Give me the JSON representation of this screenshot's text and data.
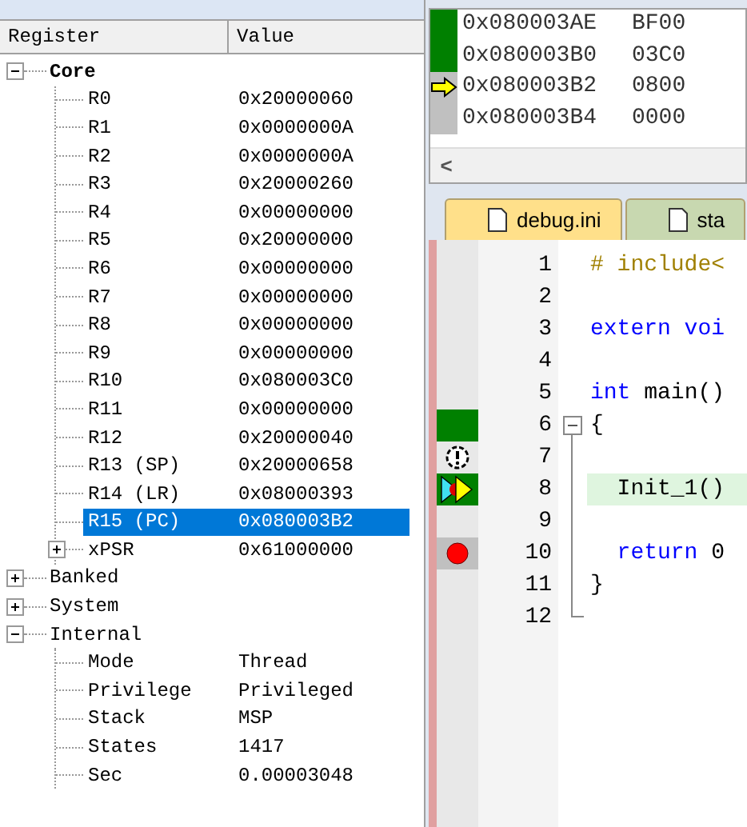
{
  "registers": {
    "columns": [
      "Register",
      "Value"
    ],
    "groups": [
      {
        "label": "Core",
        "bold": true,
        "expanded": true,
        "children": [
          {
            "name": "R0",
            "value": "0x20000060",
            "kind": "leaf",
            "selected": false
          },
          {
            "name": "R1",
            "value": "0x0000000A",
            "kind": "leaf",
            "selected": false
          },
          {
            "name": "R2",
            "value": "0x0000000A",
            "kind": "leaf",
            "selected": false
          },
          {
            "name": "R3",
            "value": "0x20000260",
            "kind": "leaf",
            "selected": false
          },
          {
            "name": "R4",
            "value": "0x00000000",
            "kind": "leaf",
            "selected": false
          },
          {
            "name": "R5",
            "value": "0x20000000",
            "kind": "leaf",
            "selected": false
          },
          {
            "name": "R6",
            "value": "0x00000000",
            "kind": "leaf",
            "selected": false
          },
          {
            "name": "R7",
            "value": "0x00000000",
            "kind": "leaf",
            "selected": false
          },
          {
            "name": "R8",
            "value": "0x00000000",
            "kind": "leaf",
            "selected": false
          },
          {
            "name": "R9",
            "value": "0x00000000",
            "kind": "leaf",
            "selected": false
          },
          {
            "name": "R10",
            "value": "0x080003C0",
            "kind": "leaf",
            "selected": false
          },
          {
            "name": "R11",
            "value": "0x00000000",
            "kind": "leaf",
            "selected": false
          },
          {
            "name": "R12",
            "value": "0x20000040",
            "kind": "leaf",
            "selected": false
          },
          {
            "name": "R13 (SP)",
            "value": "0x20000658",
            "kind": "leaf",
            "selected": false
          },
          {
            "name": "R14 (LR)",
            "value": "0x08000393",
            "kind": "leaf",
            "selected": false
          },
          {
            "name": "R15 (PC)",
            "value": "0x080003B2",
            "kind": "leaf",
            "selected": true
          },
          {
            "name": "xPSR",
            "value": "0x61000000",
            "kind": "expandable",
            "expanded": false,
            "selected": false
          }
        ]
      },
      {
        "label": "Banked",
        "bold": false,
        "expanded": false
      },
      {
        "label": "System",
        "bold": false,
        "expanded": false
      },
      {
        "label": "Internal",
        "bold": false,
        "expanded": true,
        "children": [
          {
            "name": "Mode",
            "value": "Thread",
            "kind": "leaf",
            "selected": false
          },
          {
            "name": "Privilege",
            "value": "Privileged",
            "kind": "leaf",
            "selected": false
          },
          {
            "name": "Stack",
            "value": "MSP",
            "kind": "leaf",
            "selected": false
          },
          {
            "name": "States",
            "value": "1417",
            "kind": "leaf",
            "selected": false
          },
          {
            "name": "Sec",
            "value": "0.00003048",
            "kind": "leaf",
            "selected": false
          }
        ]
      }
    ]
  },
  "disassembly": {
    "lines": [
      {
        "address": "0x080003AE",
        "opcode": "BF00",
        "kind": "executed"
      },
      {
        "address": "0x080003B0",
        "opcode": "03C0",
        "kind": "executed"
      },
      {
        "address": "0x080003B2",
        "opcode": "0800",
        "kind": "current"
      },
      {
        "address": "0x080003B4",
        "opcode": "0000",
        "kind": "pending"
      }
    ],
    "scroll_left": "<"
  },
  "tabs": [
    {
      "label": "debug.ini",
      "selected": true
    },
    {
      "label": "sta",
      "selected": false
    }
  ],
  "editor": {
    "lines": [
      {
        "number": "1",
        "kind": "plain",
        "highlighted": false,
        "tokens": [
          {
            "text": "# include<",
            "kind": "preproc"
          }
        ]
      },
      {
        "number": "2",
        "kind": "plain",
        "highlighted": false
      },
      {
        "number": "3",
        "kind": "plain",
        "highlighted": false,
        "tokens": [
          {
            "text": "extern voi",
            "kind": "keyword"
          }
        ]
      },
      {
        "number": "4",
        "kind": "plain",
        "highlighted": false
      },
      {
        "number": "5",
        "kind": "plain",
        "highlighted": false,
        "tokens": [
          {
            "text": "int",
            "kind": "keyword"
          },
          {
            "text": " main()",
            "kind": "plain"
          }
        ]
      },
      {
        "number": "6",
        "kind": "executed",
        "highlighted": false,
        "expanded": true,
        "tokens": [
          {
            "text": "{",
            "kind": "plain"
          }
        ]
      },
      {
        "number": "7",
        "kind": "warning",
        "highlighted": false
      },
      {
        "number": "8",
        "kind": "current",
        "highlighted": true,
        "tokens": [
          {
            "text": "  Init_1()",
            "kind": "plain"
          }
        ]
      },
      {
        "number": "9",
        "kind": "plain",
        "highlighted": false
      },
      {
        "number": "10",
        "kind": "breakpoint",
        "highlighted": false,
        "tokens": [
          {
            "text": "  return",
            "kind": "keyword"
          },
          {
            "text": " 0",
            "kind": "plain"
          }
        ]
      },
      {
        "number": "11",
        "kind": "plain",
        "highlighted": false,
        "tokens": [
          {
            "text": "}",
            "kind": "plain"
          }
        ]
      },
      {
        "number": "12",
        "kind": "plain",
        "highlighted": false
      }
    ]
  }
}
